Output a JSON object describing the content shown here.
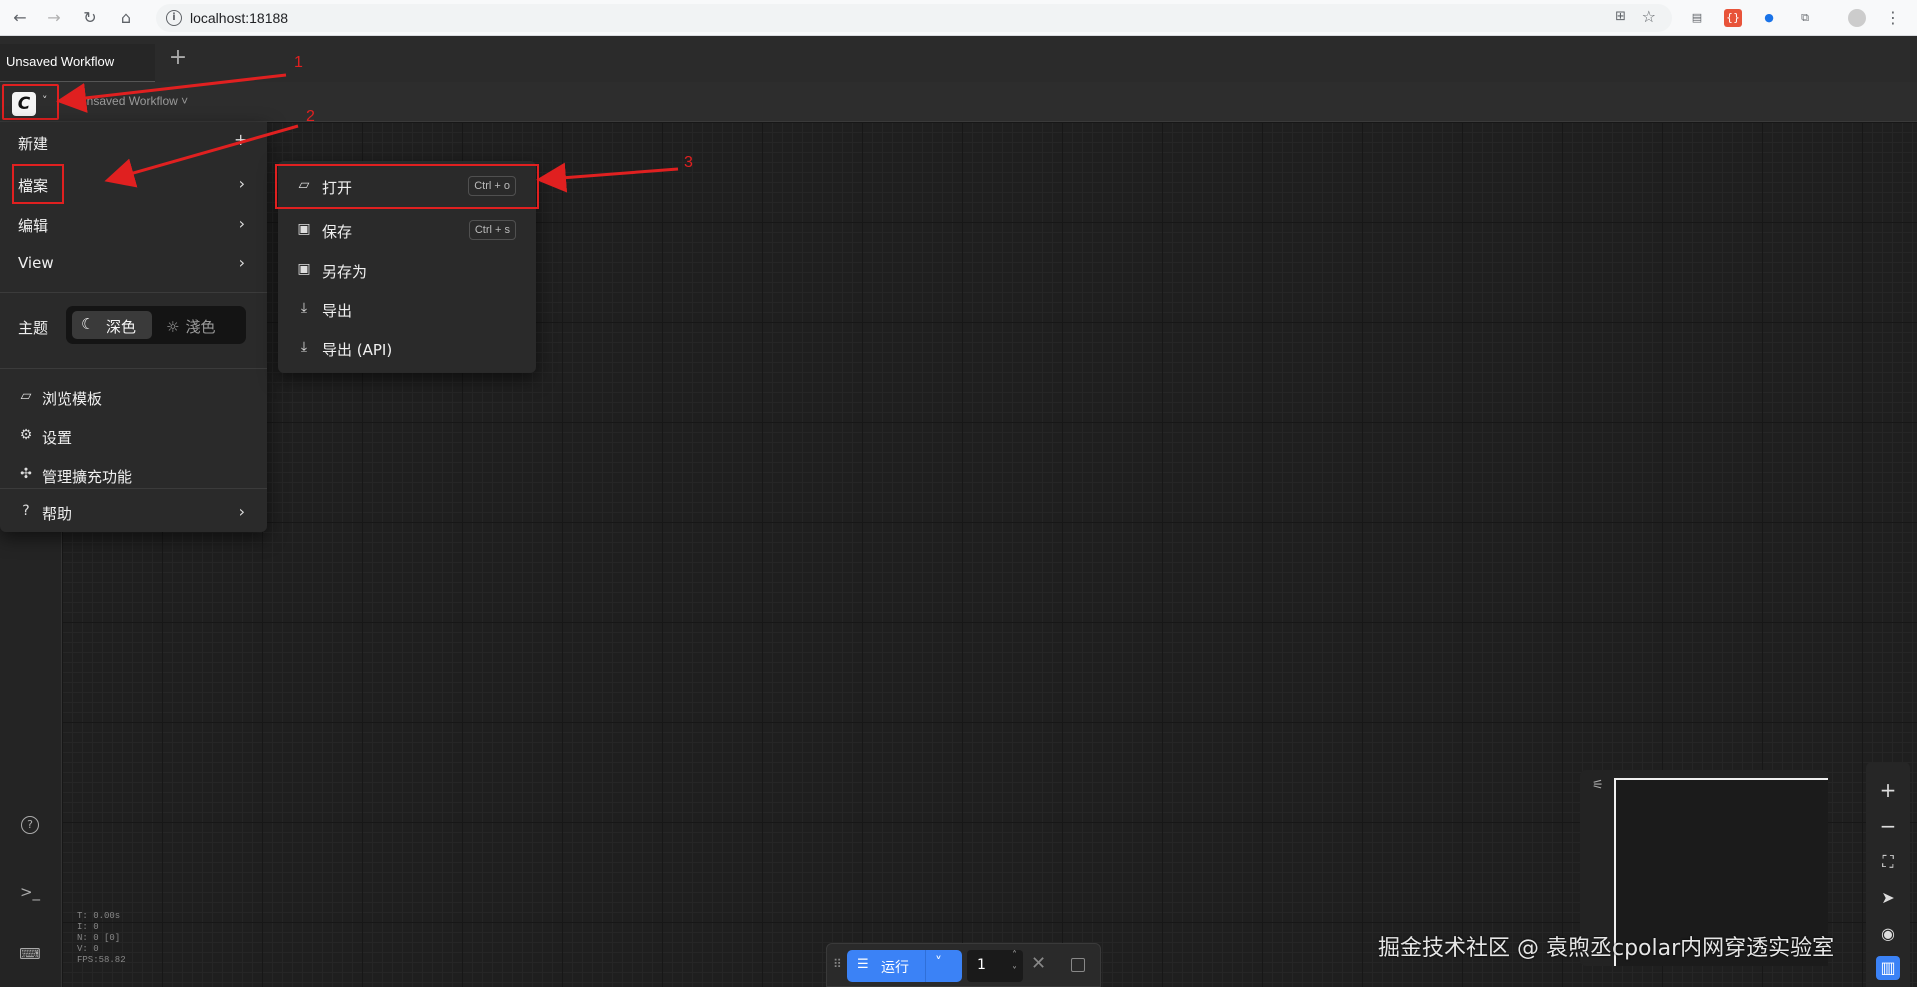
{
  "browser": {
    "url": "localhost:18188",
    "nav_back": "←",
    "nav_forward": "→",
    "nav_reload": "↻",
    "nav_home": "⌂"
  },
  "tabs": {
    "active_label": "Unsaved Workflow",
    "new_tab_label": "+"
  },
  "toolbar": {
    "logo_glyph": "C",
    "workflow_title": "Unsaved Workflow ˅"
  },
  "main_menu": {
    "new_label": "新建",
    "file_label": "檔案",
    "edit_label": "编辑",
    "view_label": "View",
    "theme_label": "主题",
    "theme_dark": "深色",
    "theme_light": "淺色",
    "browse_templates": "浏览模板",
    "settings": "设置",
    "manage_extensions": "管理擴充功能",
    "help": "帮助"
  },
  "file_submenu": {
    "items": [
      {
        "label": "打开",
        "shortcut": "Ctrl + o"
      },
      {
        "label": "保存",
        "shortcut": "Ctrl + s"
      },
      {
        "label": "另存为"
      },
      {
        "label": "导出"
      },
      {
        "label": "导出 (API)"
      }
    ]
  },
  "stats": {
    "t": "T: 0.00s",
    "i": "I: 0",
    "n": "N: 0 [0]",
    "v": "V: 0",
    "fps": "FPS:58.82"
  },
  "run_bar": {
    "run_label": "运行",
    "batch_count": "1"
  },
  "watermark": "掘金技术社区 @ 袁煦丞cpolar内网穿透实验室",
  "annotations": [
    "1",
    "2",
    "3"
  ],
  "colors": {
    "accent_blue": "#3b82f6",
    "annotation_red": "#e02020",
    "menu_bg": "#2a2a2a"
  }
}
